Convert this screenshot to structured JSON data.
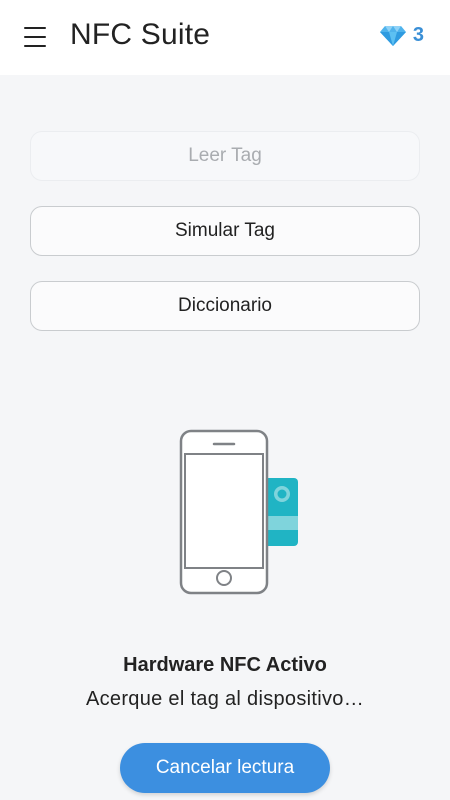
{
  "app_bar": {
    "title": "NFC Suite",
    "menu_icon": "hamburger-menu-icon",
    "credits_icon": "diamond-icon",
    "credits_count": "3"
  },
  "actions": {
    "read_tag": "Leer Tag",
    "simulate_tag": "Simular Tag",
    "dictionary": "Diccionario"
  },
  "illustration": {
    "icon": "phone-nfc-tag-icon"
  },
  "status": {
    "title": "Hardware NFC Activo",
    "message": "Acerque el tag al dispositivo…"
  },
  "cancel_button": "Cancelar lectura",
  "colors": {
    "accent": "#3c8fe0",
    "credits": "#3a8fd6",
    "tag": "#20b4c4"
  }
}
